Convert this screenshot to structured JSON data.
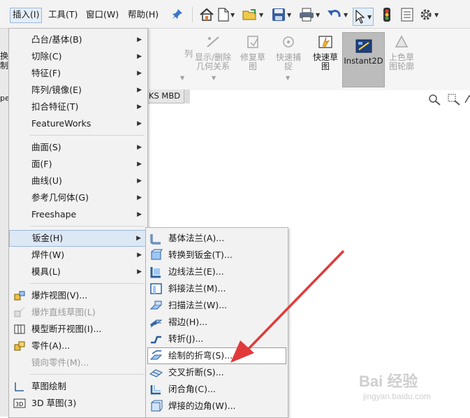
{
  "menubar": {
    "items": [
      {
        "label": "插入(I)",
        "active": true
      },
      {
        "label": "工具(T)",
        "active": false
      },
      {
        "label": "窗口(W)",
        "active": false
      },
      {
        "label": "帮助(H)",
        "active": false
      }
    ],
    "pin_icon": "pin-icon"
  },
  "toolbar": {
    "icons": [
      "home-icon",
      "new-document-icon",
      "open-folder-icon",
      "save-icon",
      "print-icon",
      "undo-icon",
      "select-pointer-icon",
      "traffic-light-icon",
      "list-options-icon",
      "gear-icon"
    ]
  },
  "ribbon": {
    "left_partial": [
      "换",
      "制"
    ],
    "array_partial": "列",
    "show_delete_relations": "显示/删除几何关系",
    "repair_sketch": "修复草图",
    "quick_snap": "快速捕捉",
    "rapid_sketch": "快速草图",
    "instant2d": "Instant2D",
    "shade_contour": "上色草图轮廓"
  },
  "tabs": {
    "left_partial": "pe",
    "mbd_partial": "KS MBD"
  },
  "main_menu": {
    "items": [
      {
        "label": "凸台/基体(B)",
        "arrow": true,
        "disabled": false
      },
      {
        "label": "切除(C)",
        "arrow": true,
        "disabled": false
      },
      {
        "label": "特征(F)",
        "arrow": true,
        "disabled": false
      },
      {
        "label": "阵列/镜像(E)",
        "arrow": true,
        "disabled": false
      },
      {
        "label": "扣合特征(T)",
        "arrow": true,
        "disabled": false
      },
      {
        "label": "FeatureWorks",
        "arrow": true,
        "disabled": false
      },
      {
        "label": "曲面(S)",
        "arrow": true,
        "disabled": false
      },
      {
        "label": "面(F)",
        "arrow": true,
        "disabled": false
      },
      {
        "label": "曲线(U)",
        "arrow": true,
        "disabled": false
      },
      {
        "label": "参考几何体(G)",
        "arrow": true,
        "disabled": false
      },
      {
        "label": "Freeshape",
        "arrow": true,
        "disabled": false
      },
      {
        "label": "钣金(H)",
        "arrow": true,
        "disabled": false,
        "highlighted": true
      },
      {
        "label": "焊件(W)",
        "arrow": true,
        "disabled": false
      },
      {
        "label": "模具(L)",
        "arrow": true,
        "disabled": false
      },
      {
        "label": "爆炸视图(V)...",
        "arrow": false,
        "disabled": false,
        "icon": "exploded-view-icon"
      },
      {
        "label": "爆炸直线草图(L)",
        "arrow": false,
        "disabled": true,
        "icon": "explode-line-sketch-icon"
      },
      {
        "label": "模型断开视图(I)...",
        "arrow": false,
        "disabled": false,
        "icon": "model-break-view-icon"
      },
      {
        "label": "零件(A)...",
        "arrow": false,
        "disabled": false,
        "icon": "part-icon"
      },
      {
        "label": "镜向零件(M)...",
        "arrow": false,
        "disabled": true
      },
      {
        "label": "草图绘制",
        "arrow": false,
        "disabled": false,
        "icon": "sketch-icon"
      },
      {
        "label": "3D 草图(3)",
        "arrow": false,
        "disabled": false,
        "icon": "3d-sketch-icon"
      }
    ]
  },
  "sheet_metal_submenu": {
    "items": [
      {
        "label": "基体法兰(A)...",
        "icon": "base-flange-icon"
      },
      {
        "label": "转换到钣金(T)...",
        "icon": "convert-to-sheet-metal-icon"
      },
      {
        "label": "边线法兰(E)...",
        "icon": "edge-flange-icon"
      },
      {
        "label": "斜接法兰(M)...",
        "icon": "miter-flange-icon"
      },
      {
        "label": "扫描法兰(W)...",
        "icon": "swept-flange-icon"
      },
      {
        "label": "褶边(H)...",
        "icon": "hem-icon"
      },
      {
        "label": "转折(J)...",
        "icon": "jog-icon"
      },
      {
        "label": "绘制的折弯(S)...",
        "icon": "sketched-bend-icon",
        "highlighted": true
      },
      {
        "label": "交叉折断(S)...",
        "icon": "cross-break-icon"
      },
      {
        "label": "闭合角(C)...",
        "icon": "closed-corner-icon"
      },
      {
        "label": "焊接的边角(W)...",
        "icon": "welded-corner-icon"
      }
    ]
  },
  "watermark": {
    "brand": "Bai 经验",
    "url": "jingyan.baidu.com"
  },
  "colors": {
    "menu_bg": "#f2f2f2",
    "highlight_bg": "#dde8f5",
    "highlight_border": "#9ab7dd",
    "annotation_arrow": "#e23a3a"
  }
}
